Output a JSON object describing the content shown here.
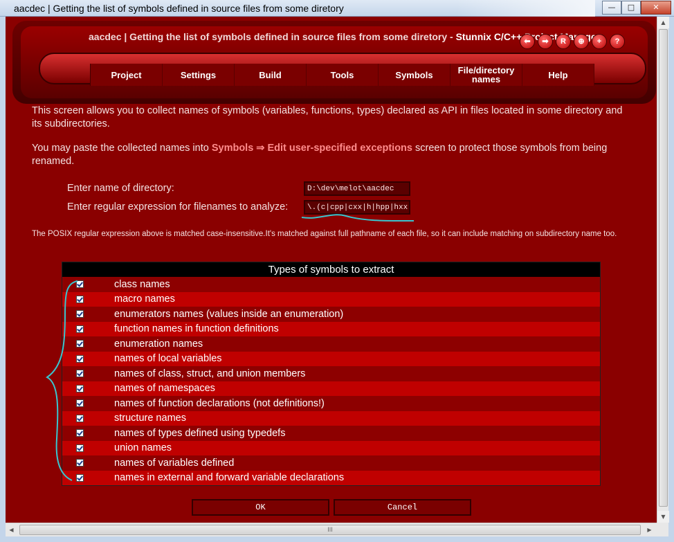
{
  "window": {
    "title": "aacdec | Getting the list of symbols defined in source files from some diretory",
    "buttons": {
      "minimize": "—",
      "maximize": "□",
      "close": "✕"
    }
  },
  "header": {
    "title": "aacdec | Getting the list of symbols defined in source files from some diretory -",
    "brand": "Stunnix C/C++ Project Manager",
    "nav_buttons": [
      {
        "icon": "back-arrow-icon",
        "glyph": "⬅"
      },
      {
        "icon": "forward-arrow-icon",
        "glyph": "➡"
      },
      {
        "icon": "reload-icon",
        "glyph": "R"
      },
      {
        "icon": "zoom-in-icon",
        "glyph": "⊕"
      },
      {
        "icon": "add-icon",
        "glyph": "+"
      },
      {
        "icon": "help-icon",
        "glyph": "?"
      }
    ]
  },
  "menu": [
    {
      "label": "Project"
    },
    {
      "label": "Settings"
    },
    {
      "label": "Build"
    },
    {
      "label": "Tools"
    },
    {
      "label": "Symbols"
    },
    {
      "label": "File/directory names"
    },
    {
      "label": "Help"
    }
  ],
  "intro": {
    "p1": "This screen allows you to collect names of symbols (variables, functions, types) declared as API in files located in some directory and its subdirectories.",
    "p2_before": "You may paste the collected names into",
    "p2_link": "Symbols ⇒ Edit user-specified exceptions",
    "p2_after": "screen to protect those symbols from being renamed."
  },
  "form": {
    "dir_label": "Enter name of directory:",
    "dir_value": "D:\\dev\\melot\\aacdec",
    "regex_label": "Enter regular expression for filenames to analyze:",
    "regex_value": "\\.(c|cpp|cxx|h|hpp|hxx)$"
  },
  "note": "The POSIX regular expression above is matched case-insensitive.It's matched against full pathname of each file, so it can include matching on subdirectory name too.",
  "symbol_types": {
    "header": "Types of symbols to extract",
    "items": [
      {
        "label": "class names",
        "checked": true
      },
      {
        "label": "macro names",
        "checked": true
      },
      {
        "label": "enumerators names (values inside an enumeration)",
        "checked": true
      },
      {
        "label": "function names in function definitions",
        "checked": true
      },
      {
        "label": "enumeration names",
        "checked": true
      },
      {
        "label": "names of local variables",
        "checked": true
      },
      {
        "label": "names of class, struct, and union members",
        "checked": true
      },
      {
        "label": "names of namespaces",
        "checked": true
      },
      {
        "label": "names of function declarations (not definitions!)",
        "checked": true
      },
      {
        "label": "structure names",
        "checked": true
      },
      {
        "label": "names of types defined using typedefs",
        "checked": true
      },
      {
        "label": "union names",
        "checked": true
      },
      {
        "label": "names of variables defined",
        "checked": true
      },
      {
        "label": "names in external and forward variable declarations",
        "checked": true
      }
    ]
  },
  "buttons": {
    "ok": "OK",
    "cancel": "Cancel"
  },
  "scrollbar": {
    "h_grip": "III"
  },
  "colors": {
    "background": "#8a0000",
    "row_odd": "#8d0000",
    "row_even": "#c00000",
    "link": "#ff8c8c",
    "annotation": "#39c6cf"
  }
}
